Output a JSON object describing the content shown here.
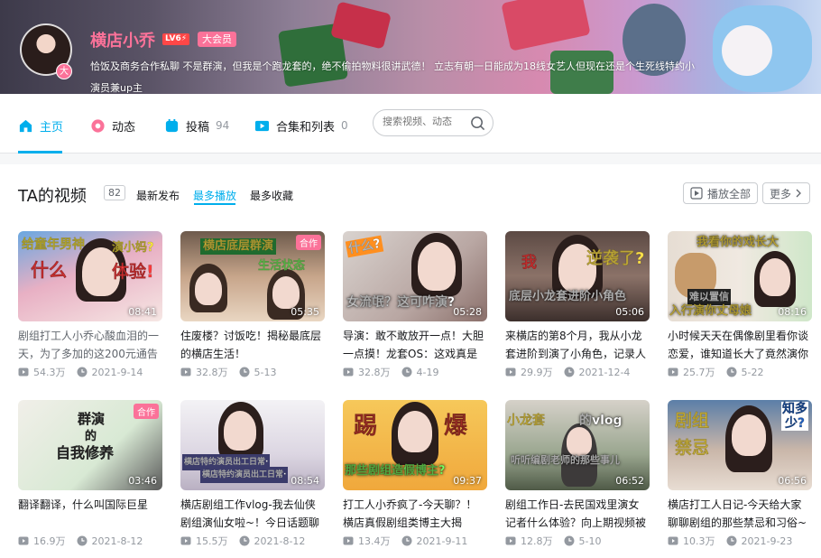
{
  "profile": {
    "username": "横店小乔",
    "level": "LV6⚡",
    "vip": "大会员",
    "avatar_badge": "大",
    "sign_line1": "恰饭及商务合作私聊 不是群演，但我是个跑龙套的，绝不偷拍物料很讲武德！ 立志有朝一日能成为18线女艺人但现在还是个生死线特约小",
    "sign_line2": "演员兼up主"
  },
  "nav": {
    "items": [
      {
        "label": "主页",
        "icon": "home-icon"
      },
      {
        "label": "动态",
        "icon": "dynamic-icon"
      },
      {
        "label": "投稿",
        "icon": "upload-icon",
        "count": "94"
      },
      {
        "label": "合集和列表",
        "icon": "collection-icon",
        "count": "0"
      }
    ],
    "search_placeholder": "搜索视频、动态"
  },
  "section": {
    "title": "TA的视频",
    "count": "82",
    "sorts": [
      "最新发布",
      "最多播放",
      "最多收藏"
    ],
    "play_all": "播放全部",
    "more": "更多"
  },
  "videos": [
    {
      "title": "剧组打工人小乔心酸血泪的一天，为了多加的这200元通告",
      "views": "54.3万",
      "date": "2021-9-14",
      "duration": "08:41",
      "caption1": "给童年男神",
      "caption2": "什么",
      "caption3": "演小妈?",
      "caption4": "体验!",
      "dim": true
    },
    {
      "title": "住废楼？讨饭吃！揭秘最底层的横店生活！",
      "views": "32.8万",
      "date": "5-13",
      "duration": "05:35",
      "caption1": "横店底层群演",
      "caption2": "生活状态",
      "tag": "合作"
    },
    {
      "title": "导演：敢不敢放开一点！大胆一点摸！龙套OS：这戏真是",
      "views": "32.8万",
      "date": "4-19",
      "duration": "05:28",
      "caption1": "什么?",
      "caption2": "女流氓？这可咋演?"
    },
    {
      "title": "来横店的第8个月，我从小龙套进阶到演了小角色，记录人",
      "views": "29.9万",
      "date": "2021-12-4",
      "duration": "05:06",
      "caption1": "我",
      "caption2": "逆袭了?",
      "caption3": "底层小龙套进阶小角色"
    },
    {
      "title": "小时候天天在偶像剧里看你谈恋爱，谁知道长大了竟然演你",
      "views": "25.7万",
      "date": "5-22",
      "duration": "08:16",
      "caption1": "我看你的戏长大",
      "caption2": "难以置信",
      "caption3": "入行演你丈母娘"
    },
    {
      "title": "翻译翻译，什么叫国际巨星",
      "views": "16.9万",
      "date": "2021-8-12",
      "duration": "03:46",
      "caption1": "群演",
      "caption2": "的",
      "caption3": "自我修养",
      "tag": "合作"
    },
    {
      "title": "横店剧组工作vlog-我去仙侠剧组演仙女啦~！今日话题聊",
      "views": "15.5万",
      "date": "2021-8-12",
      "duration": "08:54",
      "caption1": "横店特约演员出工日常·",
      "caption2": "横店特约演员出工日常·"
    },
    {
      "title": "打工人小乔疯了-今天聊？！横店真假剧组类博主大揭",
      "views": "13.4万",
      "date": "2021-9-11",
      "duration": "09:37",
      "caption1": "踢",
      "caption2": "爆",
      "caption3": "那些剧组造假博主?"
    },
    {
      "title": "剧组工作日-去民国戏里演女记者什么体验？向上期视频被",
      "views": "12.8万",
      "date": "5-10",
      "duration": "06:52",
      "caption1": "小龙套",
      "caption2": "的vlog",
      "caption3": "听听编剧老师的那些事儿"
    },
    {
      "title": "横店打工人日记-今天给大家聊聊剧组的那些禁忌和习俗~",
      "views": "10.3万",
      "date": "2021-9-23",
      "duration": "06:56",
      "caption1": "剧组",
      "caption2": "禁忌",
      "caption3": "知多少?"
    }
  ],
  "colors": {
    "accent": "#00aeec",
    "pink": "#fb7299",
    "text_gray": "#9499a0"
  }
}
